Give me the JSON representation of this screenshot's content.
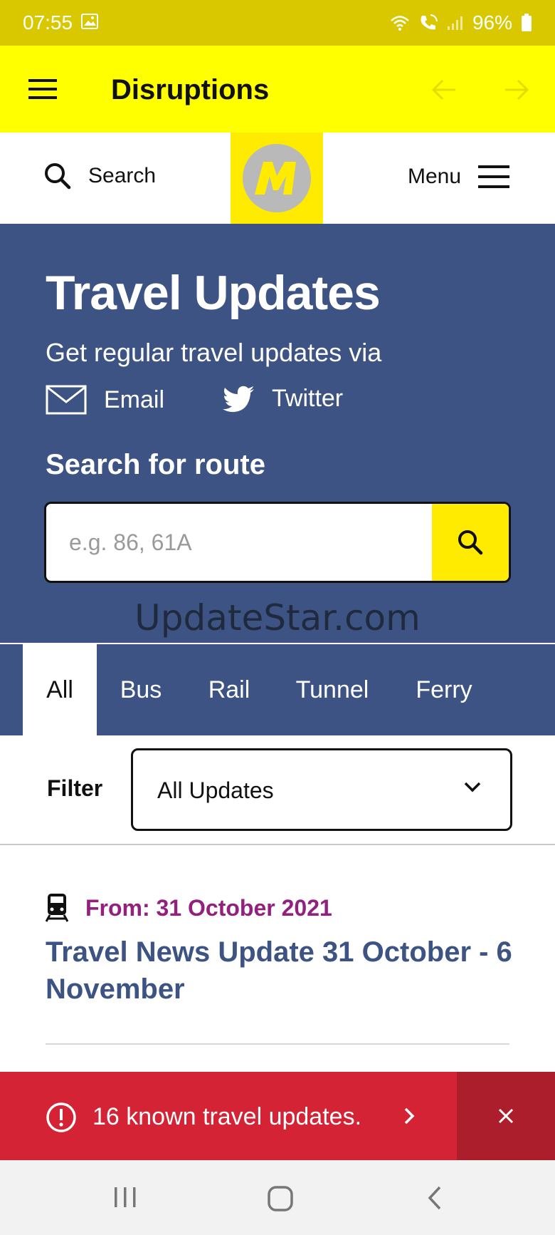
{
  "status_bar": {
    "time": "07:55",
    "battery": "96%"
  },
  "app_bar": {
    "title": "Disruptions"
  },
  "site_header": {
    "search_label": "Search",
    "menu_label": "Menu"
  },
  "hero": {
    "title": "Travel Updates",
    "subtitle": "Get regular travel updates via",
    "email_label": "Email",
    "twitter_label": "Twitter",
    "route_heading": "Search for route",
    "route_placeholder": "e.g. 86, 61A",
    "watermark": "UpdateStar.com"
  },
  "tabs": [
    {
      "label": "All",
      "active": true
    },
    {
      "label": "Bus",
      "active": false
    },
    {
      "label": "Rail",
      "active": false
    },
    {
      "label": "Tunnel",
      "active": false
    },
    {
      "label": "Ferry",
      "active": false
    }
  ],
  "filter": {
    "label": "Filter",
    "selected": "All Updates"
  },
  "updates": [
    {
      "icon": "train-icon",
      "from": "From: 31 October 2021",
      "headline": "Travel News Update 31 October - 6 November"
    }
  ],
  "alert": {
    "message": "16 known travel updates."
  },
  "colors": {
    "status_bar": "#d9c800",
    "app_bar": "#ffff00",
    "brand_yellow": "#ffeb00",
    "brand_blue": "#3c5383",
    "date_purple": "#93207e",
    "alert_red": "#d42334"
  }
}
